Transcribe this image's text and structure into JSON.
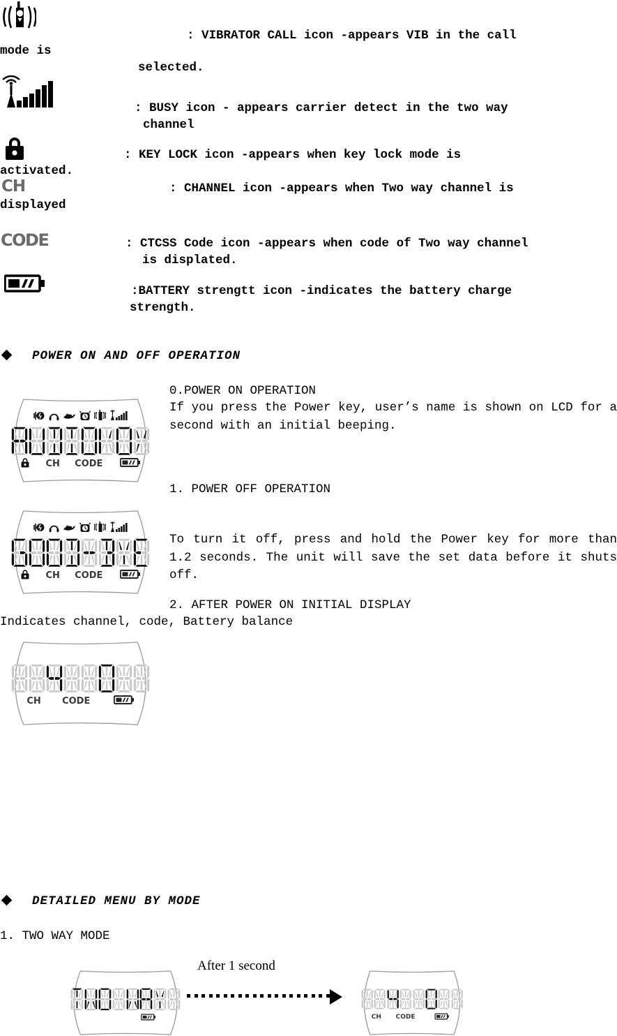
{
  "document": {
    "title": "Two-Way Radio User Manual - Icon Legend and Power Operation"
  },
  "legend": {
    "items": [
      {
        "icon": "vibrator-call-icon",
        "text": ": VIBRATOR CALL icon -appears VIB in the call mode is",
        "text_cont": "mode is",
        "text_line2": "selected."
      },
      {
        "icon": "busy-signal-icon",
        "text": ": BUSY icon - appears carrier detect in the two way",
        "text_line2": "channel"
      },
      {
        "icon": "key-lock-icon",
        "text": ": KEY LOCK icon -appears when key lock mode is",
        "text_line2": "activated."
      },
      {
        "icon": "channel-ch-icon",
        "icon_label": "CH",
        "text": ": CHANNEL icon -appears when Two way channel is",
        "text_line2": "displayed"
      },
      {
        "icon": "ctcss-code-icon",
        "icon_label": "CODE",
        "text": ": CTCSS Code icon -appears when code of Two way channel",
        "text_line2": "is displated."
      },
      {
        "icon": "battery-strength-icon",
        "text": ":BATTERY strengtt icon -indicates the battery charge",
        "text_line2": "strength."
      }
    ],
    "line1_main": ": VIBRATOR CALL icon -appears VIB in the call",
    "line1_wrap": "mode is",
    "line1_indent": "selected.",
    "line2_main": ": BUSY icon - appears carrier detect in the two way",
    "line2_indent": "channel",
    "line3_main": ":  KEY  LOCK  icon  -appears  when  key  lock  mode  is",
    "line3_wrap": "activated.",
    "line4_main": ": CHANNEL icon -appears when Two way channel is",
    "line4_wrap": "displayed",
    "line5_main": ": CTCSS Code icon -appears when code of Two way channel",
    "line5_indent": "is displated.",
    "line6_main": ":BATTERY strengtt icon -indicates the battery charge",
    "line6_indent": "strength."
  },
  "section_power": {
    "heading": "POWER ON AND OFF OPERATION",
    "bullet": "diamond-bullet",
    "item0_title": "0.POWER ON OPERATION",
    "item0_body": "If you press the Power key, user’s name is shown on LCD for a second with an initial beeping.",
    "item1_title": "1. POWER OFF OPERATION",
    "item1_body": "To turn it off, press and hold the Power key for more than 1.2 seconds. The unit will save the set data before it shuts off.",
    "item2_title": "2. AFTER POWER ON INITIAL DISPLAY",
    "item2_body": "Indicates channel, code, Battery balance"
  },
  "section_menu": {
    "heading": "DETAILED MENU BY MODE",
    "bullet": "diamond-bullet",
    "item1_title": "1. TWO WAY MODE",
    "transition_label": "After 1 second"
  },
  "lcd_displays": [
    {
      "name": "lcd-power-on",
      "text": "AUDIOVOX",
      "chars": [
        "A",
        "U",
        "D",
        "I",
        "O",
        "V",
        "O",
        "X"
      ],
      "status_icons": [
        "battery-plug-icon",
        "headphone-icon",
        "bird-icon",
        "alarm-clock-icon",
        "vibrate-radio-icon",
        "signal-bars-icon"
      ],
      "bottom": {
        "lock": "key-lock-icon",
        "ch_label": "CH",
        "code_label": "CODE",
        "battery": "battery-strength-icon"
      }
    },
    {
      "name": "lcd-power-off",
      "text": "GOOD-BYE",
      "chars": [
        "G",
        "O",
        "O",
        "D",
        "-",
        "B",
        "Y",
        "E"
      ],
      "status_icons": [
        "battery-plug-icon",
        "headphone-icon",
        "bird-icon",
        "alarm-clock-icon",
        "vibrate-radio-icon",
        "signal-bars-icon"
      ],
      "bottom": {
        "lock": "key-lock-icon",
        "ch_label": "CH",
        "code_label": "CODE",
        "battery": "battery-strength-icon"
      }
    },
    {
      "name": "lcd-initial-display",
      "text": "  4  0  ",
      "chars": [
        " ",
        " ",
        "4",
        " ",
        " ",
        "0",
        " ",
        " "
      ],
      "channel_value": "4",
      "code_value": "0",
      "status_icons": [],
      "bottom": {
        "ch_label": "CH",
        "code_label": "CODE",
        "battery": "battery-strength-icon"
      }
    },
    {
      "name": "lcd-two-way-mode",
      "text": "TWO WAY ",
      "chars": [
        "T",
        "W",
        "O",
        " ",
        "W",
        "A",
        "Y",
        " "
      ],
      "status_icons": [],
      "bottom": {
        "battery": "battery-strength-icon"
      }
    },
    {
      "name": "lcd-two-way-result",
      "text": "  4  0  ",
      "chars": [
        " ",
        " ",
        "4",
        " ",
        " ",
        "0",
        " ",
        " "
      ],
      "channel_value": "4",
      "code_value": "0",
      "status_icons": [],
      "bottom": {
        "ch_label": "CH",
        "code_label": "CODE",
        "battery": "battery-strength-icon"
      }
    }
  ],
  "colors": {
    "text": "#000000",
    "lcd_ghost": "#c9c9c9",
    "lcd_active": "#111111",
    "lcd_label": "#555555",
    "frame": "#9a9a9a"
  }
}
